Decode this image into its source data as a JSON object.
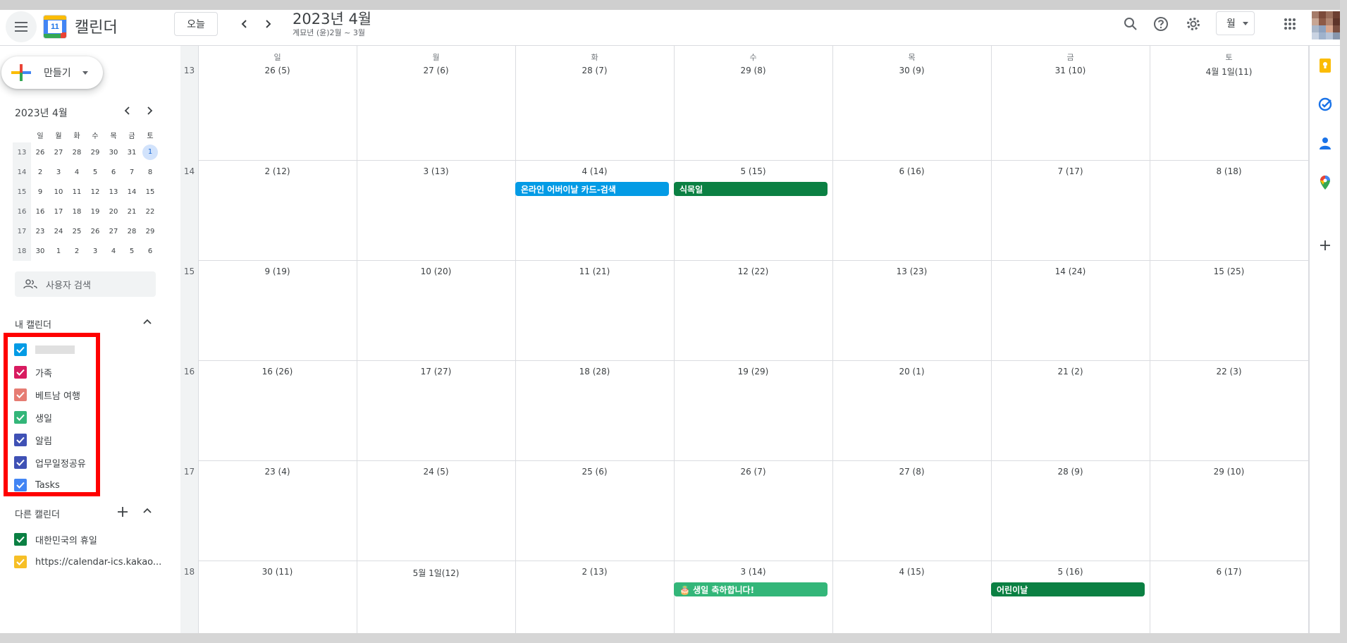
{
  "header": {
    "app_name": "캘린더",
    "logo_day": "11",
    "today_label": "오늘",
    "prev_icon": "chevron-left-icon",
    "next_icon": "chevron-right-icon",
    "title": "2023년 4월",
    "subtitle": "계묘년 (윤)2월 ~ 3월",
    "view_label": "월"
  },
  "sidebar": {
    "create_label": "만들기",
    "mini_title": "2023년 4월",
    "mini_weekdays": [
      "일",
      "월",
      "화",
      "수",
      "목",
      "금",
      "토"
    ],
    "mini_weeks": [
      {
        "wk": "13",
        "days": [
          "26",
          "27",
          "28",
          "29",
          "30",
          "31",
          "1"
        ]
      },
      {
        "wk": "14",
        "days": [
          "2",
          "3",
          "4",
          "5",
          "6",
          "7",
          "8"
        ]
      },
      {
        "wk": "15",
        "days": [
          "9",
          "10",
          "11",
          "12",
          "13",
          "14",
          "15"
        ]
      },
      {
        "wk": "16",
        "days": [
          "16",
          "17",
          "18",
          "19",
          "20",
          "21",
          "22"
        ]
      },
      {
        "wk": "17",
        "days": [
          "23",
          "24",
          "25",
          "26",
          "27",
          "28",
          "29"
        ]
      },
      {
        "wk": "18",
        "days": [
          "30",
          "1",
          "2",
          "3",
          "4",
          "5",
          "6"
        ]
      }
    ],
    "search_placeholder": "사용자 검색",
    "my_calendars_title": "내 캘린더",
    "my_calendars": [
      {
        "label": "",
        "color": "#039be5"
      },
      {
        "label": "가족",
        "color": "#d81b60"
      },
      {
        "label": "베트남 여행",
        "color": "#e67c73"
      },
      {
        "label": "생일",
        "color": "#33b679"
      },
      {
        "label": "알림",
        "color": "#3f51b5"
      },
      {
        "label": "업무일정공유",
        "color": "#3f51b5"
      },
      {
        "label": "Tasks",
        "color": "#4285f4"
      }
    ],
    "other_calendars_title": "다른 캘린더",
    "other_calendars": [
      {
        "label": "대한민국의 휴일",
        "color": "#0b8043"
      },
      {
        "label": "https://calendar-ics.kakao...",
        "color": "#f6bf26"
      }
    ]
  },
  "grid": {
    "weekdays": [
      "일",
      "월",
      "화",
      "수",
      "목",
      "금",
      "토"
    ],
    "weeks": [
      {
        "wk": "13",
        "days": [
          "26 (5)",
          "27 (6)",
          "28 (7)",
          "29 (8)",
          "30 (9)",
          "31 (10)",
          "4월 1일(11)"
        ]
      },
      {
        "wk": "14",
        "days": [
          "2  (12)",
          "3  (13)",
          "4  (14)",
          "5  (15)",
          "6  (16)",
          "7  (17)",
          "8  (18)"
        ]
      },
      {
        "wk": "15",
        "days": [
          "9  (19)",
          "10 (20)",
          "11 (21)",
          "12 (22)",
          "13 (23)",
          "14 (24)",
          "15 (25)"
        ]
      },
      {
        "wk": "16",
        "days": [
          "16 (26)",
          "17 (27)",
          "18 (28)",
          "19 (29)",
          "20 (1)",
          "21 (2)",
          "22 (3)"
        ]
      },
      {
        "wk": "17",
        "days": [
          "23 (4)",
          "24 (5)",
          "25 (6)",
          "26 (7)",
          "27 (8)",
          "28 (9)",
          "29 (10)"
        ]
      },
      {
        "wk": "18",
        "days": [
          "30 (11)",
          "5월 1일(12)",
          "2  (13)",
          "3  (14)",
          "4  (15)",
          "5  (16)",
          "6  (17)"
        ]
      }
    ],
    "events": [
      {
        "label": "온라인 어버이날 카드-검색",
        "color": "#039be5",
        "week": 1,
        "day": 2
      },
      {
        "label": "식목일",
        "color": "#0b8043",
        "week": 1,
        "day": 3
      },
      {
        "label": "🎂 생일 축하합니다!",
        "color": "#33b679",
        "week": 5,
        "day": 3
      },
      {
        "label": "어린이날",
        "color": "#0b8043",
        "week": 5,
        "day": 5
      }
    ]
  },
  "rail": {
    "icons": [
      "keep-icon",
      "tasks-icon",
      "contacts-icon",
      "maps-icon",
      "add-icon"
    ]
  },
  "colors": {
    "accent": "#1a73e8",
    "highlight_border": "#ff0000"
  }
}
